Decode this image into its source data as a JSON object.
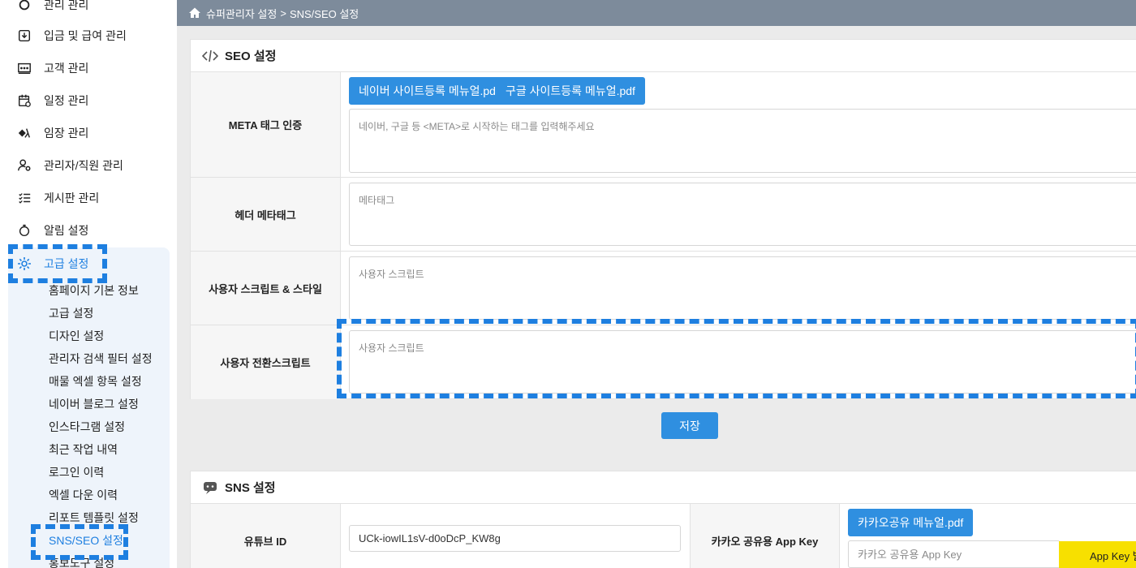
{
  "sidebar": {
    "top_partial": "관리 관리",
    "items": [
      {
        "label": "입금 및 급여 관리",
        "icon": "download-box-icon"
      },
      {
        "label": "고객 관리",
        "icon": "customers-icon"
      },
      {
        "label": "일정 관리",
        "icon": "calendar-icon"
      },
      {
        "label": "임장 관리",
        "icon": "field-visit-icon"
      },
      {
        "label": "관리자/직원 관리",
        "icon": "user-settings-icon"
      },
      {
        "label": "게시판 관리",
        "icon": "list-icon"
      },
      {
        "label": "알림 설정",
        "icon": "bell-icon"
      }
    ],
    "active": {
      "label": "고급 설정",
      "icon": "gear-icon"
    },
    "sub_items": [
      "홈페이지 기본 정보",
      "고급 설정",
      "디자인 설정",
      "관리자 검색 필터 설정",
      "매물 엑셀 항목 설정",
      "네이버 블로그 설정",
      "인스타그램 설정",
      "최근 작업 내역",
      "로그인 이력",
      "엑셀 다운 이력",
      "리포트 템플릿 설정",
      "SNS/SEO 설정",
      "홍보도구 설정"
    ]
  },
  "breadcrumb": {
    "parent": "슈퍼관리자 설정",
    "separator": ">",
    "current": "SNS/SEO 설정"
  },
  "seo": {
    "title": "SEO 설정",
    "naver_manual_btn": "네이버 사이트등록 메뉴얼.pdf",
    "google_manual_btn": "구글 사이트등록 메뉴얼.pdf",
    "rows": [
      {
        "label": "META 태그 인증",
        "placeholder": "네이버, 구글 등 <META>로 시작하는 태그를 입력해주세요"
      },
      {
        "label": "헤더 메타태그",
        "placeholder": "메타태그"
      },
      {
        "label": "사용자 스크립트 & 스타일",
        "placeholder": "사용자 스크립트"
      },
      {
        "label": "사용자 전환스크립트",
        "placeholder": "사용자 스크립트"
      }
    ],
    "save_btn": "저장"
  },
  "sns": {
    "title": "SNS 설정",
    "youtube_label": "유튜브 ID",
    "youtube_value": "UCk-iowIL1sV-d0oDcP_KW8g",
    "kakao_label": "카카오 공유용 App Key",
    "kakao_manual_btn": "카카오공유 메뉴얼.pdf",
    "kakao_placeholder": "카카오 공유용 App Key",
    "kakao_issue_btn": "App Key 발급"
  },
  "colors": {
    "accent": "#2f8fe0",
    "highlight": "#1e7fe0",
    "topbar": "#7d8b9b",
    "kakao_yellow": "#f7e000"
  }
}
